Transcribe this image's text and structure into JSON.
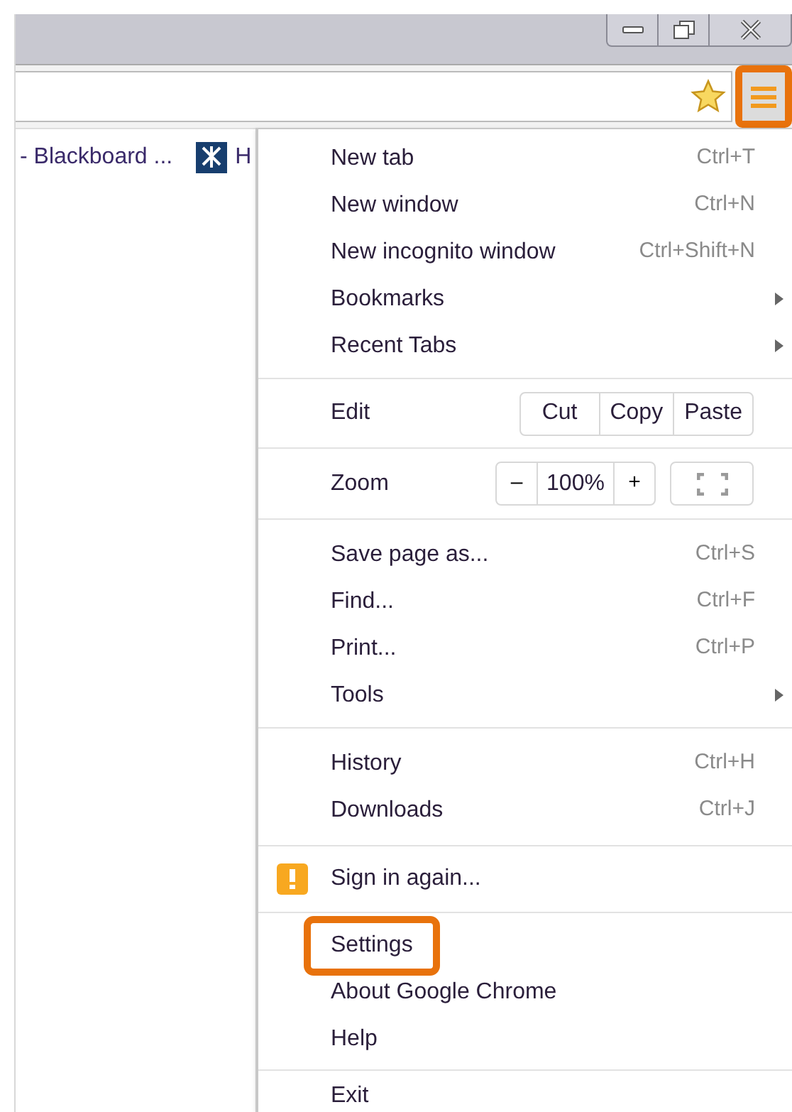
{
  "bookmarks_bar": {
    "items": [
      {
        "label": "- Blackboard ..."
      },
      {
        "label": "H"
      }
    ]
  },
  "toolbar": {
    "menu_button_highlighted": true
  },
  "menu": {
    "sections": [
      {
        "items": [
          {
            "kind": "command",
            "label": "New tab",
            "shortcut": "Ctrl+T",
            "submenu": false,
            "highlighted": false
          },
          {
            "kind": "command",
            "label": "New window",
            "shortcut": "Ctrl+N",
            "submenu": false,
            "highlighted": false
          },
          {
            "kind": "command",
            "label": "New incognito window",
            "shortcut": "Ctrl+Shift+N",
            "submenu": false,
            "highlighted": false
          },
          {
            "kind": "command",
            "label": "Bookmarks",
            "submenu": true,
            "highlighted": false
          },
          {
            "kind": "command",
            "label": "Recent Tabs",
            "submenu": true,
            "highlighted": false
          }
        ]
      },
      {
        "items": [
          {
            "kind": "edit",
            "label": "Edit",
            "buttons": [
              "Cut",
              "Copy",
              "Paste"
            ]
          }
        ]
      },
      {
        "items": [
          {
            "kind": "zoom",
            "label": "Zoom",
            "minus": "–",
            "value": "100%",
            "plus": "+"
          }
        ]
      },
      {
        "items": [
          {
            "kind": "command",
            "label": "Save page as...",
            "shortcut": "Ctrl+S",
            "submenu": false,
            "highlighted": false
          },
          {
            "kind": "command",
            "label": "Find...",
            "shortcut": "Ctrl+F",
            "submenu": false,
            "highlighted": false
          },
          {
            "kind": "command",
            "label": "Print...",
            "shortcut": "Ctrl+P",
            "submenu": false,
            "highlighted": false
          },
          {
            "kind": "command",
            "label": "Tools",
            "submenu": true,
            "highlighted": false
          }
        ]
      },
      {
        "items": [
          {
            "kind": "command",
            "label": "History",
            "shortcut": "Ctrl+H",
            "submenu": false,
            "highlighted": false
          },
          {
            "kind": "command",
            "label": "Downloads",
            "shortcut": "Ctrl+J",
            "submenu": false,
            "highlighted": false
          }
        ]
      },
      {
        "items": [
          {
            "kind": "warning",
            "label": "Sign in again..."
          }
        ]
      },
      {
        "items": [
          {
            "kind": "command",
            "label": "Settings",
            "submenu": false,
            "highlighted": true
          },
          {
            "kind": "command",
            "label": "About Google Chrome",
            "submenu": false,
            "highlighted": false
          },
          {
            "kind": "command",
            "label": "Help",
            "submenu": false,
            "highlighted": false
          }
        ]
      },
      {
        "items": [
          {
            "kind": "command",
            "label": "Exit",
            "submenu": false,
            "highlighted": false
          }
        ]
      }
    ]
  }
}
